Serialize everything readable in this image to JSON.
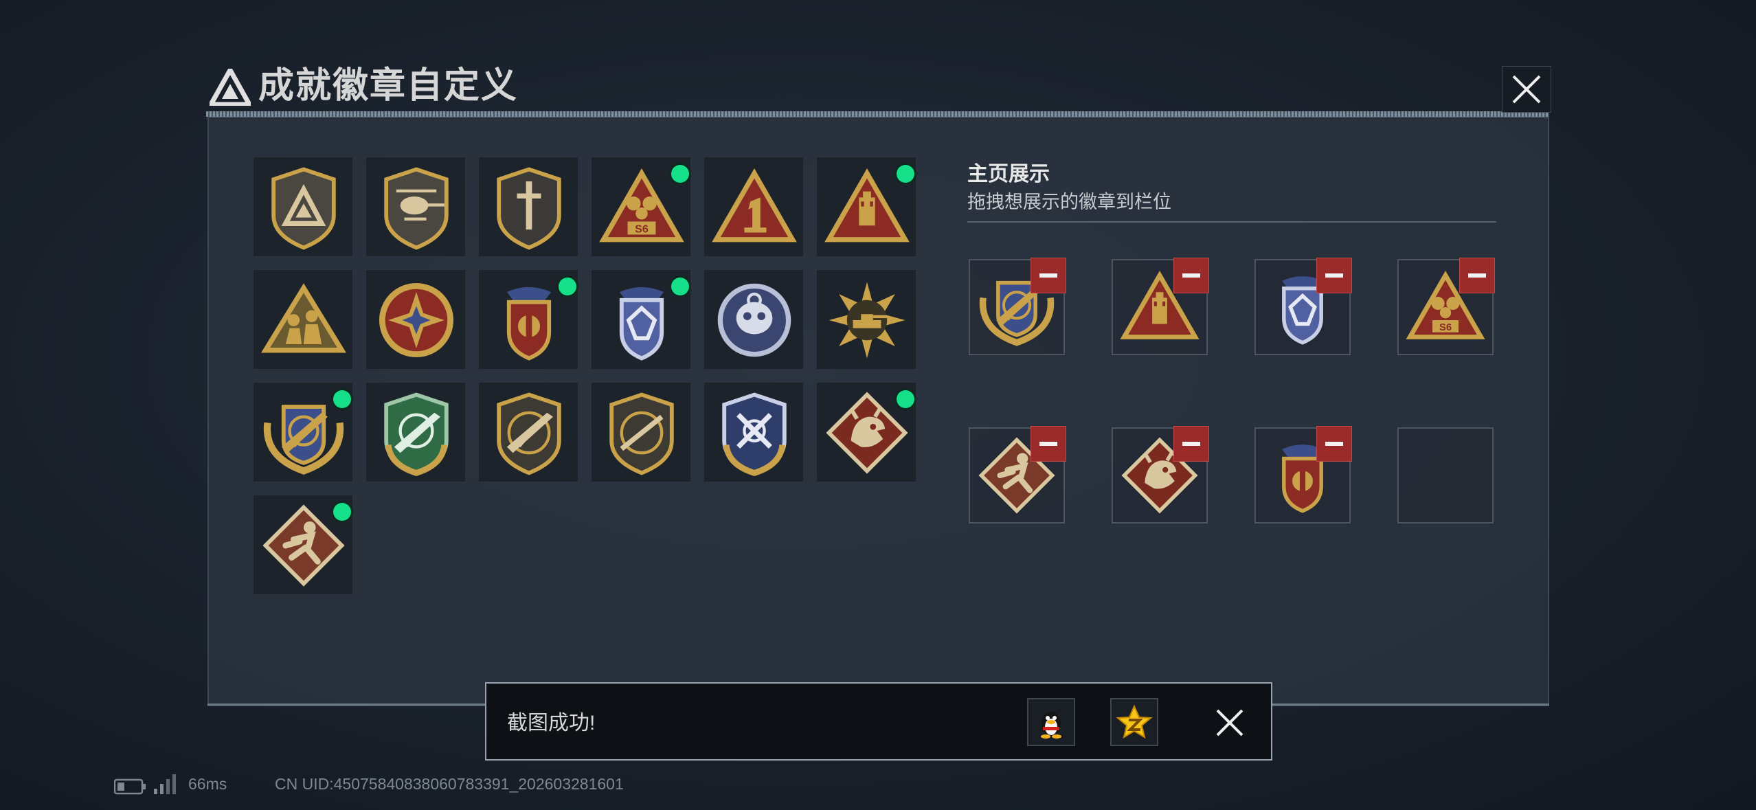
{
  "header": {
    "title": "成就徽章自定义",
    "deco_text": "",
    "logo_icon": "triangle-logo-icon",
    "close_icon": "close-icon"
  },
  "badge_grid": {
    "items": [
      {
        "icon": "triangle-shield-badge",
        "equipped": false
      },
      {
        "icon": "helicopter-badge",
        "equipped": false
      },
      {
        "icon": "sword-shield-badge",
        "equipped": false
      },
      {
        "icon": "s6-triangle-badge",
        "equipped": true
      },
      {
        "icon": "number-one-triangle-badge",
        "equipped": false
      },
      {
        "icon": "usb-triangle-badge",
        "equipped": true
      },
      {
        "icon": "soldiers-triangle-badge",
        "equipped": false
      },
      {
        "icon": "star-compass-badge",
        "equipped": false
      },
      {
        "icon": "red-star-crest-badge",
        "equipped": true
      },
      {
        "icon": "blue-diamond-crest-badge",
        "equipped": true
      },
      {
        "icon": "skull-crosshair-badge",
        "equipped": false
      },
      {
        "icon": "tank-burst-badge",
        "equipped": false
      },
      {
        "icon": "gold-rifle-wings-badge",
        "equipped": true
      },
      {
        "icon": "green-crosshair-rifle-badge",
        "equipped": false
      },
      {
        "icon": "rifle-shield-badge",
        "equipped": false
      },
      {
        "icon": "sniper-shield-badge",
        "equipped": false
      },
      {
        "icon": "blue-blades-badge",
        "equipped": false
      },
      {
        "icon": "dragon-diamond-badge",
        "equipped": true
      },
      {
        "icon": "runner-diamond-badge",
        "equipped": true
      }
    ]
  },
  "showcase": {
    "title": "主页展示",
    "subtitle": "拖拽想展示的徽章到栏位",
    "slots": [
      {
        "icon": "gold-rifle-wings-badge",
        "filled": true
      },
      {
        "icon": "usb-triangle-badge",
        "filled": true
      },
      {
        "icon": "blue-diamond-crest-badge",
        "filled": true
      },
      {
        "icon": "s6-triangle-badge",
        "filled": true
      },
      {
        "icon": "runner-diamond-badge",
        "filled": true
      },
      {
        "icon": "dragon-diamond-badge",
        "filled": true
      },
      {
        "icon": "red-star-crest-badge",
        "filled": true
      },
      {
        "icon": "",
        "filled": false
      }
    ],
    "remove_icon": "minus-icon"
  },
  "toast": {
    "message": "截图成功!",
    "share_qq_icon": "qq-penguin-icon",
    "share_qzone_icon": "qzone-star-icon",
    "close_icon": "close-icon"
  },
  "status_bar": {
    "ping": "66ms",
    "uid": "CN UID:45075840838060783391_202603281601",
    "battery_icon": "battery-icon",
    "signal_icon": "signal-icon"
  },
  "colors": {
    "equipped_dot": "#16e08a",
    "remove_button": "#9b2a2a",
    "gold": "#c9a24a",
    "red": "#8c2a24",
    "blue": "#3c4f8a",
    "green": "#2f6b45"
  }
}
